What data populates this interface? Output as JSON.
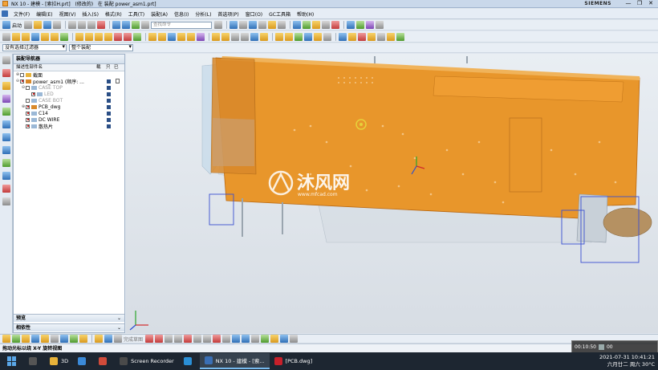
{
  "window": {
    "title": "NX 10 - 建模 - [索拉H.prt]   (修改的)   在 装配 power_asm1.prt]",
    "brand": "SIEMENS",
    "min": "—",
    "max": "❐",
    "close": "✕"
  },
  "menubar": {
    "start": "启动",
    "items": [
      "文件(F)",
      "编辑(E)",
      "视图(V)",
      "插入(S)",
      "格式(R)",
      "工具(T)",
      "装配(A)",
      "信息(I)",
      "分析(L)",
      "首选项(P)",
      "窗口(O)",
      "GC工具箱",
      "帮助(H)"
    ]
  },
  "toolbar1": {
    "start_label": "启动",
    "search_placeholder": "查找命令"
  },
  "toolbar3": {
    "filter_value": "没有选择过滤器",
    "scope_value": "整个装配"
  },
  "navigator": {
    "title": "装配导航器",
    "columns": [
      "描述性部件名",
      "载",
      "只",
      "已"
    ],
    "rows": [
      {
        "indent": 0,
        "toggle": "⊕",
        "label": "截面",
        "checked": false,
        "dim": false,
        "icon": "folder",
        "save": false
      },
      {
        "indent": 0,
        "toggle": "⊖",
        "label": "power_asm1 (顺序: ...",
        "checked": true,
        "dim": false,
        "icon": "assembly",
        "save": true
      },
      {
        "indent": 1,
        "toggle": "⊖",
        "label": "CASE TOP",
        "checked": false,
        "dim": true,
        "icon": "part",
        "save": true
      },
      {
        "indent": 2,
        "toggle": "",
        "label": "LED",
        "checked": true,
        "dim": true,
        "icon": "part",
        "save": true
      },
      {
        "indent": 1,
        "toggle": "",
        "label": "CASE BOT",
        "checked": false,
        "dim": true,
        "icon": "part",
        "save": true
      },
      {
        "indent": 1,
        "toggle": "⊕",
        "label": "PCB_dwg",
        "checked": true,
        "dim": false,
        "icon": "assembly",
        "save": true
      },
      {
        "indent": 1,
        "toggle": "",
        "label": "C14",
        "checked": true,
        "dim": false,
        "icon": "part",
        "save": true
      },
      {
        "indent": 1,
        "toggle": "",
        "label": "DC WIRE",
        "checked": true,
        "dim": false,
        "icon": "part",
        "save": true
      },
      {
        "indent": 1,
        "toggle": "",
        "label": "散热片",
        "checked": true,
        "dim": false,
        "icon": "part",
        "save": true
      }
    ],
    "sections": [
      {
        "label": "预览",
        "chevron": "⌄"
      },
      {
        "label": "相依性",
        "chevron": "⌄"
      }
    ]
  },
  "viewport": {
    "watermark": "沐风网",
    "watermark_url": "www.mfcad.com",
    "accent": "#e8962b"
  },
  "bottombar": {
    "label": "完成草图"
  },
  "status": {
    "text": "拖动光标以绕 X-Y 旋转视图"
  },
  "recorder": {
    "time": "00:10:50",
    "extra": "00"
  },
  "taskbar": {
    "tasks": [
      {
        "label": "3D",
        "color": "#e8b33a",
        "active": false
      },
      {
        "label": "",
        "color": "#3b8ad8",
        "active": false
      },
      {
        "label": "",
        "color": "#d14b3a",
        "active": false
      },
      {
        "label": "Screen Recorder",
        "color": "#4a4a4a",
        "active": false
      },
      {
        "label": "",
        "color": "#2a8fd6",
        "active": false
      },
      {
        "label": "NX 10 - 建模 - [索...",
        "color": "#3a6fb5",
        "active": true
      },
      {
        "label": "[PCB.dwg]",
        "color": "#c8202a",
        "active": false
      }
    ],
    "date": "2021-07-31 10:41:21",
    "weekday": "六月廿二 周六 30°C"
  }
}
